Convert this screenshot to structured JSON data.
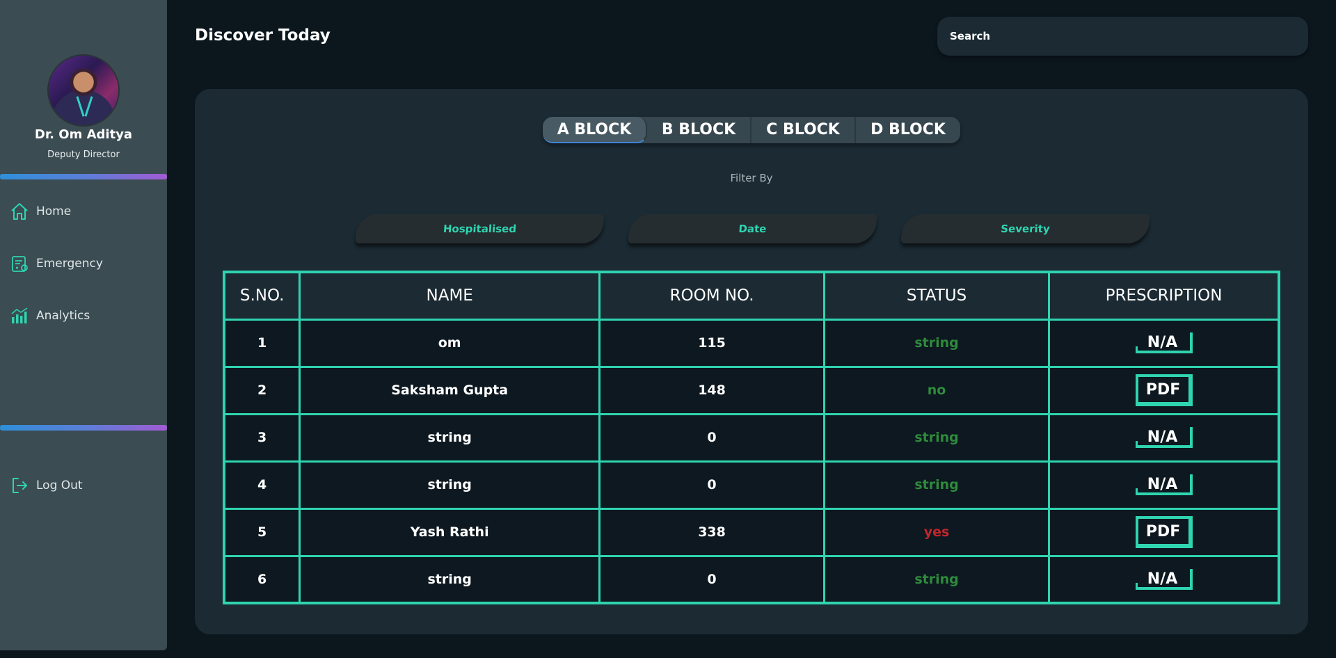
{
  "sidebar": {
    "user": {
      "name": "Dr. Om Aditya",
      "role": "Deputy Director"
    },
    "nav": [
      {
        "label": "Home",
        "icon": "home-icon"
      },
      {
        "label": "Emergency",
        "icon": "clipboard-medical-icon"
      },
      {
        "label": "Analytics",
        "icon": "bar-chart-icon"
      }
    ],
    "logout": {
      "label": "Log Out",
      "icon": "logout-icon"
    }
  },
  "header": {
    "title": "Discover Today",
    "search": {
      "placeholder": "Search",
      "value": ""
    }
  },
  "blocks": {
    "tabs": [
      "A BLOCK",
      "B BLOCK",
      "C BLOCK",
      "D BLOCK"
    ],
    "active": "A BLOCK"
  },
  "filters": {
    "label": "Filter By",
    "options": [
      "Hospitalised",
      "Date",
      "Severity"
    ]
  },
  "table": {
    "headers": [
      "S.NO.",
      "NAME",
      "ROOM NO.",
      "STATUS",
      "PRESCRIPTION"
    ],
    "rows": [
      {
        "sno": "1",
        "name": "om",
        "room": "115",
        "status": "string",
        "prescription": "N/A"
      },
      {
        "sno": "2",
        "name": "Saksham Gupta",
        "room": "148",
        "status": "no",
        "prescription": "PDF"
      },
      {
        "sno": "3",
        "name": "string",
        "room": "0",
        "status": "string",
        "prescription": "N/A"
      },
      {
        "sno": "4",
        "name": "string",
        "room": "0",
        "status": "string",
        "prescription": "N/A"
      },
      {
        "sno": "5",
        "name": "Yash Rathi",
        "room": "338",
        "status": "yes",
        "prescription": "PDF"
      },
      {
        "sno": "6",
        "name": "string",
        "room": "0",
        "status": "string",
        "prescription": "N/A"
      }
    ]
  },
  "colors": {
    "accent": "#2fd4b0",
    "status_ok": "#2e8b3c",
    "status_alert": "#c0262d",
    "sidebar_bg": "#3b4c52",
    "page_bg": "#0b161d"
  }
}
